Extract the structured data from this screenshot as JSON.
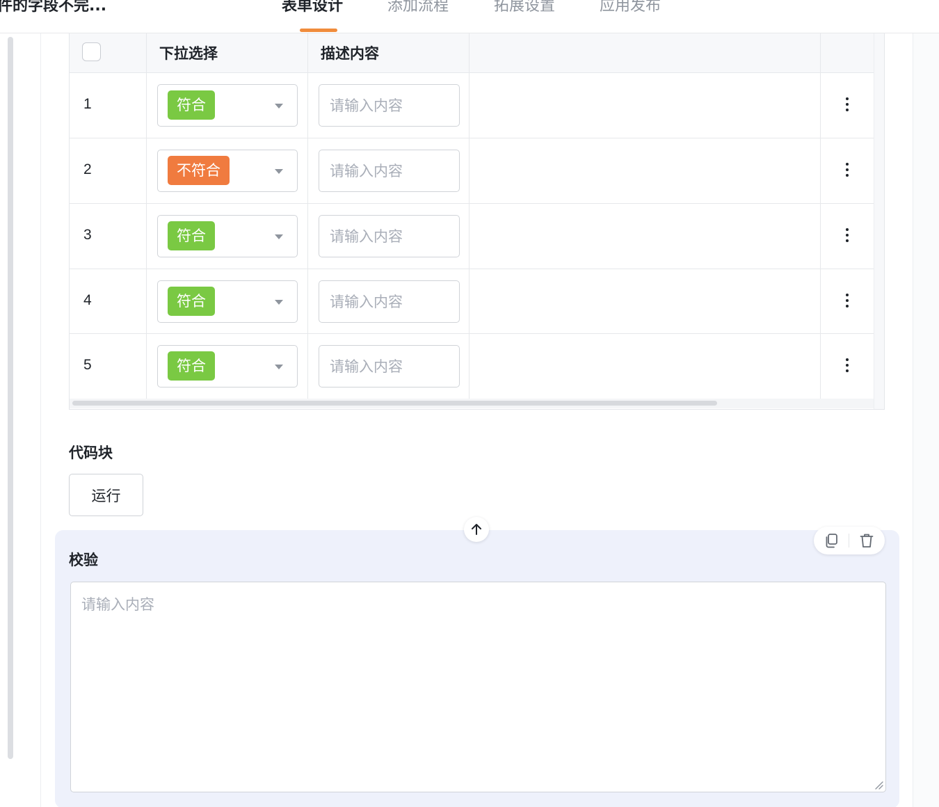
{
  "header": {
    "title": "件的字段不完...",
    "tabs": [
      {
        "label": "表单设计",
        "active": true
      },
      {
        "label": "添加流程",
        "active": false
      },
      {
        "label": "拓展设置",
        "active": false
      },
      {
        "label": "应用发布",
        "active": false
      }
    ],
    "accent_color": "#f08c3c"
  },
  "table": {
    "columns": [
      "下拉选择",
      "描述内容"
    ],
    "rows": [
      {
        "index": "1",
        "select": "符合",
        "tag_color": "#7ac943",
        "placeholder": "请输入内容"
      },
      {
        "index": "2",
        "select": "不符合",
        "tag_color": "#f07b3f",
        "placeholder": "请输入内容"
      },
      {
        "index": "3",
        "select": "符合",
        "tag_color": "#7ac943",
        "placeholder": "请输入内容"
      },
      {
        "index": "4",
        "select": "符合",
        "tag_color": "#7ac943",
        "placeholder": "请输入内容"
      },
      {
        "index": "5",
        "select": "符合",
        "tag_color": "#7ac943",
        "placeholder": "请输入内容"
      }
    ]
  },
  "code_block": {
    "label": "代码块",
    "run_label": "运行"
  },
  "verification": {
    "label": "校验",
    "placeholder": "请输入内容",
    "panel_color": "#eef1fb"
  }
}
